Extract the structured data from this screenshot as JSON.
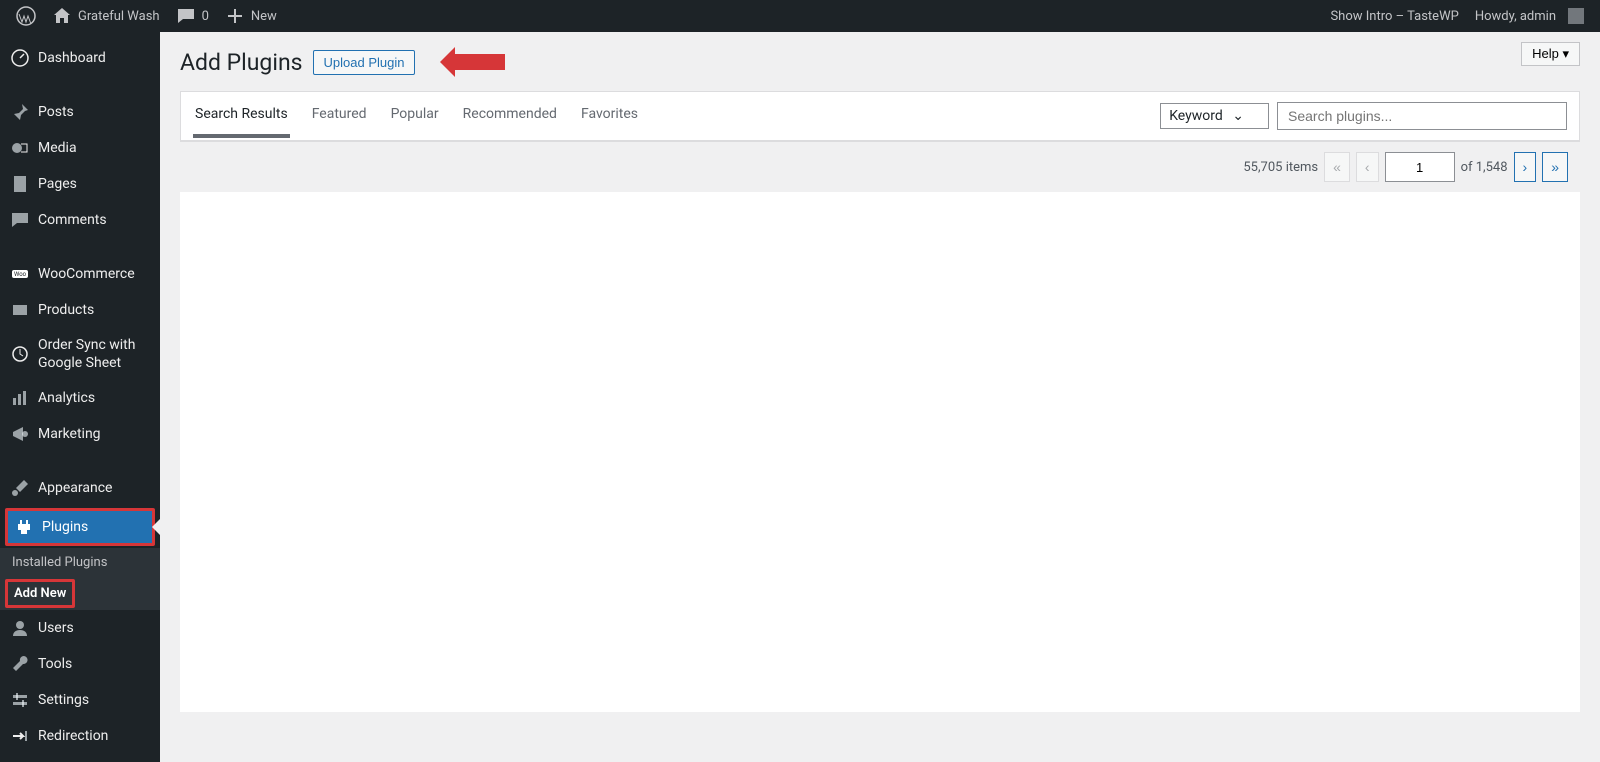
{
  "topbar": {
    "site_name": "Grateful Wash",
    "comment_count": "0",
    "new_label": "New",
    "show_intro": "Show Intro – TasteWP",
    "howdy": "Howdy, admin"
  },
  "sidebar": {
    "dashboard": "Dashboard",
    "posts": "Posts",
    "media": "Media",
    "pages": "Pages",
    "comments": "Comments",
    "woocommerce": "WooCommerce",
    "products": "Products",
    "order_sync": "Order Sync with Google Sheet",
    "analytics": "Analytics",
    "marketing": "Marketing",
    "appearance": "Appearance",
    "plugins": "Plugins",
    "installed_plugins": "Installed Plugins",
    "add_new": "Add New",
    "users": "Users",
    "tools": "Tools",
    "settings": "Settings",
    "redirection": "Redirection"
  },
  "page": {
    "title": "Add Plugins",
    "upload_btn": "Upload Plugin",
    "help": "Help ▾"
  },
  "tabs": {
    "search_results": "Search Results",
    "featured": "Featured",
    "popular": "Popular",
    "recommended": "Recommended",
    "favorites": "Favorites"
  },
  "search": {
    "type": "Keyword",
    "placeholder": "Search plugins..."
  },
  "paging": {
    "total_items": "55,705 items",
    "first": "«",
    "prev": "‹",
    "current": "1",
    "of_label": "of 1,548",
    "next": "›",
    "last": "»"
  }
}
